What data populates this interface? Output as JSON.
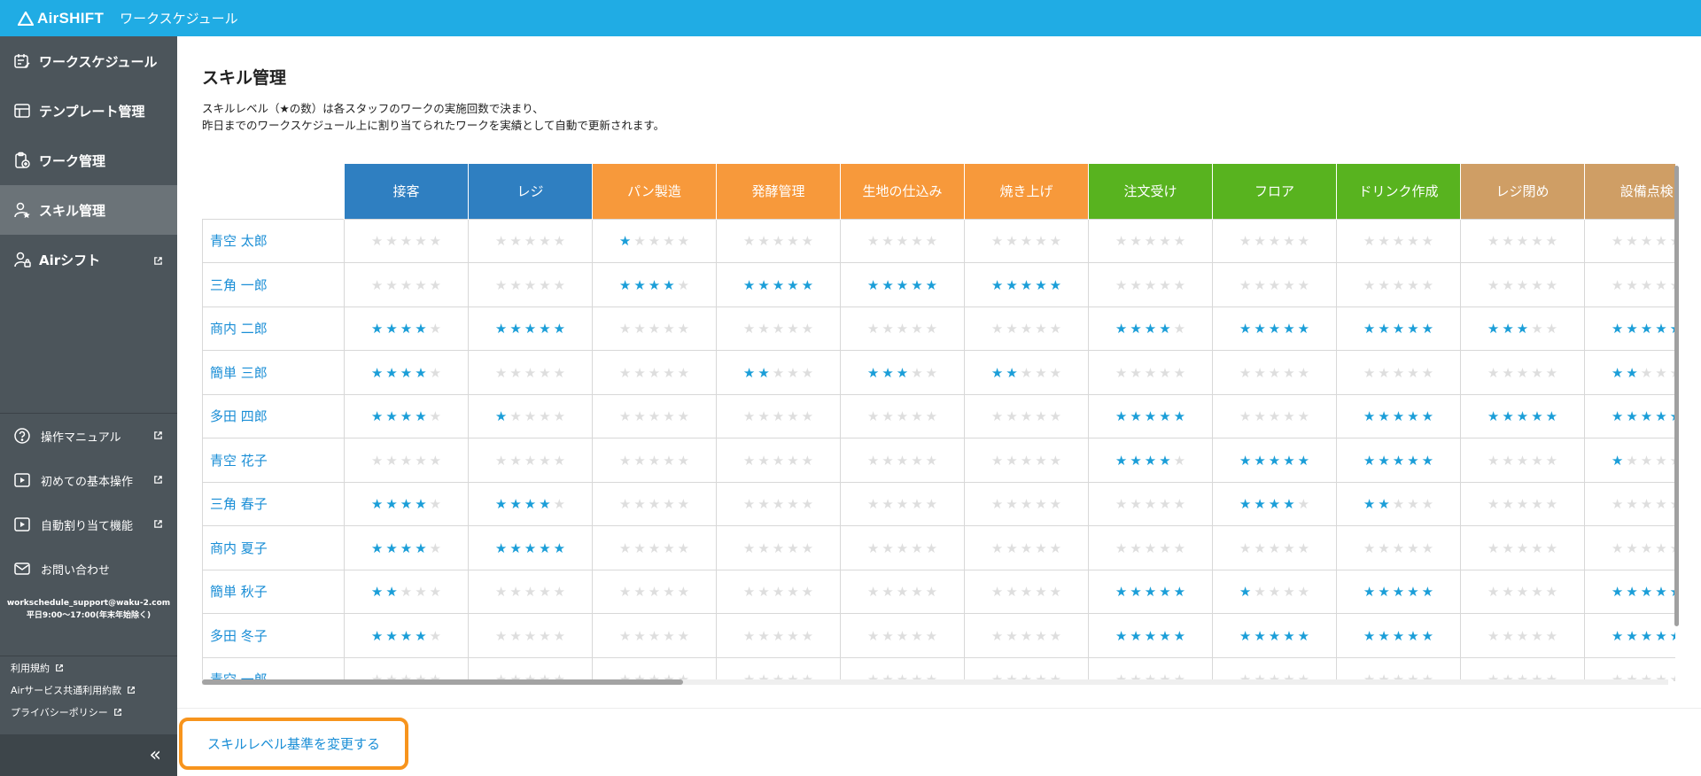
{
  "header": {
    "brand": "AirSHIFT",
    "app_title": "ワークスケジュール",
    "brand_color": "#20ace4"
  },
  "sidebar": {
    "nav": [
      {
        "label": "ワークスケジュール",
        "icon": "calendar-edit-icon"
      },
      {
        "label": "テンプレート管理",
        "icon": "template-icon"
      },
      {
        "label": "ワーク管理",
        "icon": "clipboard-add-icon"
      },
      {
        "label": "スキル管理",
        "icon": "user-star-icon",
        "active": true
      },
      {
        "label": "Airシフト",
        "icon": "user-lock-icon",
        "external": true
      }
    ],
    "help": [
      {
        "label": "操作マニュアル",
        "icon": "question-icon"
      },
      {
        "label": "初めての基本操作",
        "icon": "play-video-icon"
      },
      {
        "label": "自動割り当て機能",
        "icon": "play-video-icon"
      },
      {
        "label": "お問い合わせ",
        "icon": "mail-icon"
      }
    ],
    "contact": {
      "email": "workschedule_support@waku-2.com",
      "hours": "平日9:00〜17:00(年末年始除く)"
    },
    "legal": [
      {
        "label": "利用規約"
      },
      {
        "label": "Airサービス共通利用約款"
      },
      {
        "label": "プライバシーポリシー"
      }
    ],
    "collapse_label": "«"
  },
  "main": {
    "title": "スキル管理",
    "description_line1": "スキルレベル（★の数）は各スタッフのワークの実施回数で決まり、",
    "description_line2": "昨日までのワークスケジュール上に割り当てられたワークを実績として自動で更新されます。",
    "columns": [
      {
        "label": "接客",
        "color": "#2f7fc1"
      },
      {
        "label": "レジ",
        "color": "#2f7fc1"
      },
      {
        "label": "パン製造",
        "color": "#f7993b"
      },
      {
        "label": "発酵管理",
        "color": "#f7993b"
      },
      {
        "label": "生地の仕込み",
        "color": "#f7993b"
      },
      {
        "label": "焼き上げ",
        "color": "#f7993b"
      },
      {
        "label": "注文受け",
        "color": "#58b31f"
      },
      {
        "label": "フロア",
        "color": "#58b31f"
      },
      {
        "label": "ドリンク作成",
        "color": "#58b31f"
      },
      {
        "label": "レジ閉め",
        "color": "#cf9e65"
      },
      {
        "label": "設備点検",
        "color": "#cf9e65"
      }
    ],
    "staff": [
      {
        "name": "青空 太郎",
        "levels": [
          0,
          0,
          1,
          0,
          0,
          0,
          0,
          0,
          0,
          0,
          0
        ]
      },
      {
        "name": "三角 一郎",
        "levels": [
          0,
          0,
          4,
          5,
          5,
          5,
          0,
          0,
          0,
          0,
          0
        ]
      },
      {
        "name": "商内 二郎",
        "levels": [
          4,
          5,
          0,
          0,
          0,
          0,
          4,
          5,
          5,
          3,
          5
        ]
      },
      {
        "name": "簡単 三郎",
        "levels": [
          4,
          0,
          0,
          2,
          3,
          2,
          0,
          0,
          0,
          0,
          2
        ]
      },
      {
        "name": "多田 四郎",
        "levels": [
          4,
          1,
          0,
          0,
          0,
          0,
          5,
          0,
          5,
          5,
          5
        ]
      },
      {
        "name": "青空 花子",
        "levels": [
          0,
          0,
          0,
          0,
          0,
          0,
          4,
          5,
          5,
          0,
          1
        ]
      },
      {
        "name": "三角 春子",
        "levels": [
          4,
          4,
          0,
          0,
          0,
          0,
          0,
          4,
          2,
          0,
          0
        ]
      },
      {
        "name": "商内 夏子",
        "levels": [
          4,
          5,
          0,
          0,
          0,
          0,
          0,
          0,
          0,
          0,
          0
        ]
      },
      {
        "name": "簡単 秋子",
        "levels": [
          2,
          0,
          0,
          0,
          0,
          0,
          5,
          1,
          5,
          0,
          5
        ]
      },
      {
        "name": "多田 冬子",
        "levels": [
          4,
          0,
          0,
          0,
          0,
          0,
          5,
          5,
          5,
          0,
          5
        ]
      },
      {
        "name": "青空 一郎",
        "levels": [
          0,
          0,
          0,
          0,
          0,
          0,
          0,
          0,
          0,
          0,
          0
        ]
      }
    ],
    "max_level": 5,
    "star_on_color": "#1b9ed8",
    "star_off_color": "#dedede"
  },
  "footer": {
    "change_button": "スキルレベル基準を変更する",
    "accent": "#f7941d"
  }
}
